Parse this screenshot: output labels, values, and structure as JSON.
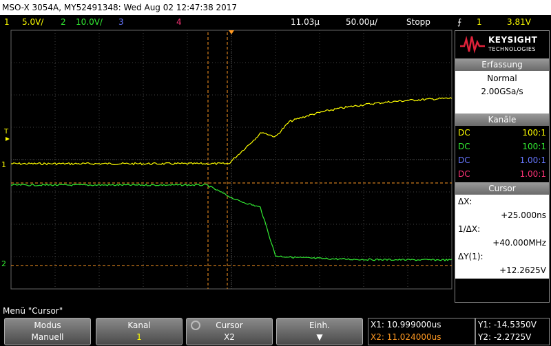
{
  "title": "MSO-X 3054A, MY52491348: Wed Aug 02 12:47:38 2017",
  "status": {
    "ch1_num": "1",
    "ch1_scale": "5.0V/",
    "ch2_num": "2",
    "ch2_scale": "10.0V/",
    "ch3_num": "3",
    "ch4_num": "4",
    "time_pos": "11.03µ",
    "time_scale": "50.00µ/",
    "run_state": "Stopp",
    "trig_icon": "trigger-edge-icon",
    "trig_source": "1",
    "trig_level": "3.81V"
  },
  "logo": {
    "brand": "KEYSIGHT",
    "sub": "TECHNOLOGIES"
  },
  "acquisition": {
    "header": "Erfassung",
    "mode": "Normal",
    "rate": "2.00GSa/s"
  },
  "channels": {
    "header": "Kanäle",
    "rows": [
      {
        "coupling": "DC",
        "probe": "100:1",
        "color": "#ffff00"
      },
      {
        "coupling": "DC",
        "probe": "100:1",
        "color": "#33ee33"
      },
      {
        "coupling": "DC",
        "probe": "1.00:1",
        "color": "#6677ff"
      },
      {
        "coupling": "DC",
        "probe": "1.00:1",
        "color": "#ff3377"
      }
    ]
  },
  "cursor": {
    "header": "Cursor",
    "dx_label": "ΔX:",
    "dx_value": "+25.000ns",
    "inv_label": "1/ΔX:",
    "inv_value": "+40.000MHz",
    "dy_label": "ΔY(1):",
    "dy_value": "+12.2625V"
  },
  "menu": "Menü \"Cursor\"",
  "softkeys": [
    {
      "top": "Modus",
      "bottom": "Manuell"
    },
    {
      "top": "Kanal",
      "bottom": "1"
    },
    {
      "top": "Cursor",
      "bottom": "X2"
    },
    {
      "top": "Einh.",
      "bottom": ""
    }
  ],
  "readout": {
    "x1": "X1: 10.999000us",
    "x2": "X2: 11.024000us",
    "y1": "Y1: -14.5350V",
    "y2": "Y2: -2.2725V"
  },
  "markers": {
    "ch1": "1",
    "ch2": "2",
    "trigger": "T"
  },
  "colors": {
    "ch1": "#ffff00",
    "ch2": "#33ee33",
    "ch3": "#6677ff",
    "ch4": "#ff3377",
    "cursor": "#ff9922",
    "grid": "#4a4a4a"
  }
}
